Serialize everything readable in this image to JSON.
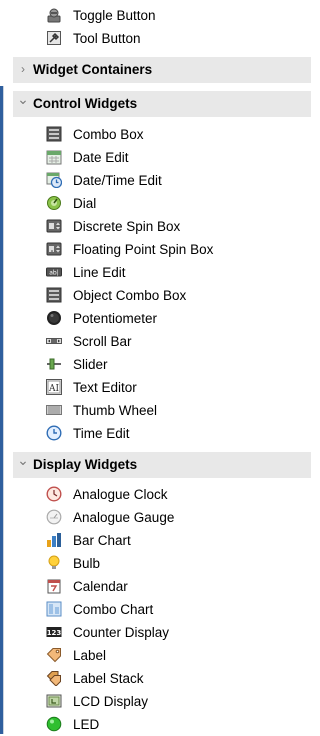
{
  "top_items": [
    {
      "label": "Toggle Button",
      "icon": "toggle-button-icon"
    },
    {
      "label": "Tool Button",
      "icon": "tool-button-icon"
    }
  ],
  "categories": [
    {
      "label": "Widget Containers",
      "expanded": false
    },
    {
      "label": "Control Widgets",
      "expanded": true,
      "items": [
        {
          "label": "Combo Box",
          "icon": "combo-box-icon"
        },
        {
          "label": "Date Edit",
          "icon": "date-edit-icon"
        },
        {
          "label": "Date/Time Edit",
          "icon": "date-time-edit-icon"
        },
        {
          "label": "Dial",
          "icon": "dial-icon"
        },
        {
          "label": "Discrete Spin Box",
          "icon": "discrete-spin-box-icon"
        },
        {
          "label": "Floating Point Spin Box",
          "icon": "floating-point-spin-box-icon"
        },
        {
          "label": "Line Edit",
          "icon": "line-edit-icon"
        },
        {
          "label": "Object Combo Box",
          "icon": "object-combo-box-icon"
        },
        {
          "label": "Potentiometer",
          "icon": "potentiometer-icon"
        },
        {
          "label": "Scroll Bar",
          "icon": "scroll-bar-icon"
        },
        {
          "label": "Slider",
          "icon": "slider-icon"
        },
        {
          "label": "Text Editor",
          "icon": "text-editor-icon"
        },
        {
          "label": "Thumb Wheel",
          "icon": "thumb-wheel-icon"
        },
        {
          "label": "Time Edit",
          "icon": "time-edit-icon"
        }
      ]
    },
    {
      "label": "Display Widgets",
      "expanded": true,
      "items": [
        {
          "label": "Analogue Clock",
          "icon": "analogue-clock-icon"
        },
        {
          "label": "Analogue Gauge",
          "icon": "analogue-gauge-icon"
        },
        {
          "label": "Bar Chart",
          "icon": "bar-chart-icon"
        },
        {
          "label": "Bulb",
          "icon": "bulb-icon"
        },
        {
          "label": "Calendar",
          "icon": "calendar-icon"
        },
        {
          "label": "Combo Chart",
          "icon": "combo-chart-icon"
        },
        {
          "label": "Counter Display",
          "icon": "counter-display-icon"
        },
        {
          "label": "Label",
          "icon": "label-icon"
        },
        {
          "label": "Label Stack",
          "icon": "label-stack-icon"
        },
        {
          "label": "LCD Display",
          "icon": "lcd-display-icon"
        },
        {
          "label": "LED",
          "icon": "led-icon"
        }
      ]
    }
  ],
  "icon_glyphs": {
    "chevron_collapsed": "›",
    "chevron_expanded": "⌄",
    "line_edit_text": "ab|",
    "counter_text": "123",
    "text_editor_text": "AI"
  },
  "colors": {
    "category_bg": "#e8e8e8",
    "accent_blue": "#2f5f9e"
  }
}
